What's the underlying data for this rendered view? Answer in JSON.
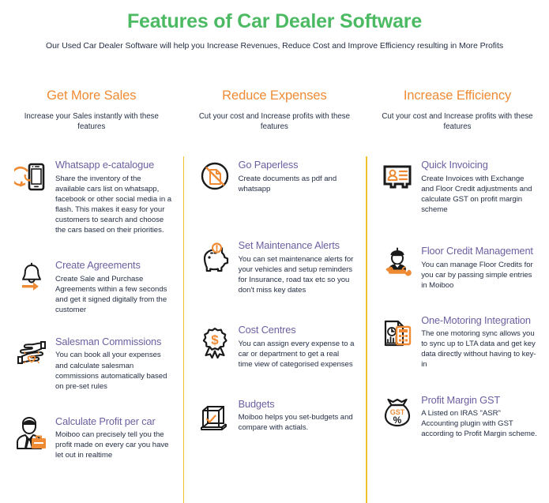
{
  "header": {
    "title": "Features of Car Dealer Software",
    "subtitle": "Our Used Car Dealer Software will help you Increase Revenues, Reduce Cost and Improve Efficiency resulting in More Profits"
  },
  "colors": {
    "title_green": "#4cba63",
    "heading_orange": "#ef8b34",
    "feature_title_purple": "#6d5fa0",
    "body_navy": "#253046",
    "divider_gold": "#f2c230",
    "icon_dark": "#1a1a1a",
    "icon_orange": "#ef8b34"
  },
  "columns": [
    {
      "id": "get-more-sales",
      "title": "Get More Sales",
      "subtitle": "Increase your Sales instantly with these features",
      "features": [
        {
          "icon": "smartphone-whatsapp-icon",
          "title": "Whatsapp e-catalogue",
          "desc": "Share the inventory of the available cars list on whatsapp, facebook or other social media in a flash. This makes it easy for your customers to search and choose the cars based on their priorities."
        },
        {
          "icon": "bell-arrow-icon",
          "title": "Create Agreements",
          "desc": "Create Sale and Purchase Agreements within a few seconds and get it signed digitally from the customer"
        },
        {
          "icon": "hands-heart-icon",
          "title": "Salesman Commissions",
          "desc": "You can book all your expenses and calculate salesman commissions automatically based on pre-set rules"
        },
        {
          "icon": "businessman-briefcase-icon",
          "title": "Calculate Profit per car",
          "desc": "Moiboo can precisely tell you the profit made on every car you have let out in realtime"
        }
      ]
    },
    {
      "id": "reduce-expenses",
      "title": "Reduce Expenses",
      "subtitle": "Cut your cost and Increase profits with these features",
      "features": [
        {
          "icon": "no-paper-icon",
          "title": "Go Paperless",
          "desc": "Create documents as pdf and whatsapp"
        },
        {
          "icon": "piggy-bank-alert-icon",
          "title": "Set Maintenance Alerts",
          "desc": "You can set maintenance alerts for your vehicles and setup reminders for Insurance, road tax etc so you don't miss key dates"
        },
        {
          "icon": "dollar-rosette-icon",
          "title": "Cost Centres",
          "desc": "You can assign every expense to a car or department to get a real time view of categorised expenses"
        },
        {
          "icon": "budget-box-check-icon",
          "title": "Budgets",
          "desc": "Moiboo helps you set-budgets and compare with actials."
        }
      ]
    },
    {
      "id": "increase-efficiency",
      "title": "Increase Efficiency",
      "subtitle": "Cut your cost and Increase profits with these features",
      "features": [
        {
          "icon": "id-card-invoice-icon",
          "title": "Quick Invoicing",
          "desc": "Create Invoices with Exchange and Floor Credit adjustments and calculate GST on profit margin scheme"
        },
        {
          "icon": "mechanic-wrench-icon",
          "title": "Floor Credit Management",
          "desc": "You can manage Floor Credits for you car by passing simple entries in Moiboo"
        },
        {
          "icon": "document-calculator-icon",
          "title": "One-Motoring Integration",
          "desc": "The one motoring sync allows you to sync up to LTA data and get key data directly without having to key-in"
        },
        {
          "icon": "money-bag-gst-icon",
          "title": "Profit Margin GST",
          "desc": "A Listed on IRAS \"ASR\" Accounting plugin with GST according to Profit Margin scheme."
        }
      ]
    }
  ]
}
